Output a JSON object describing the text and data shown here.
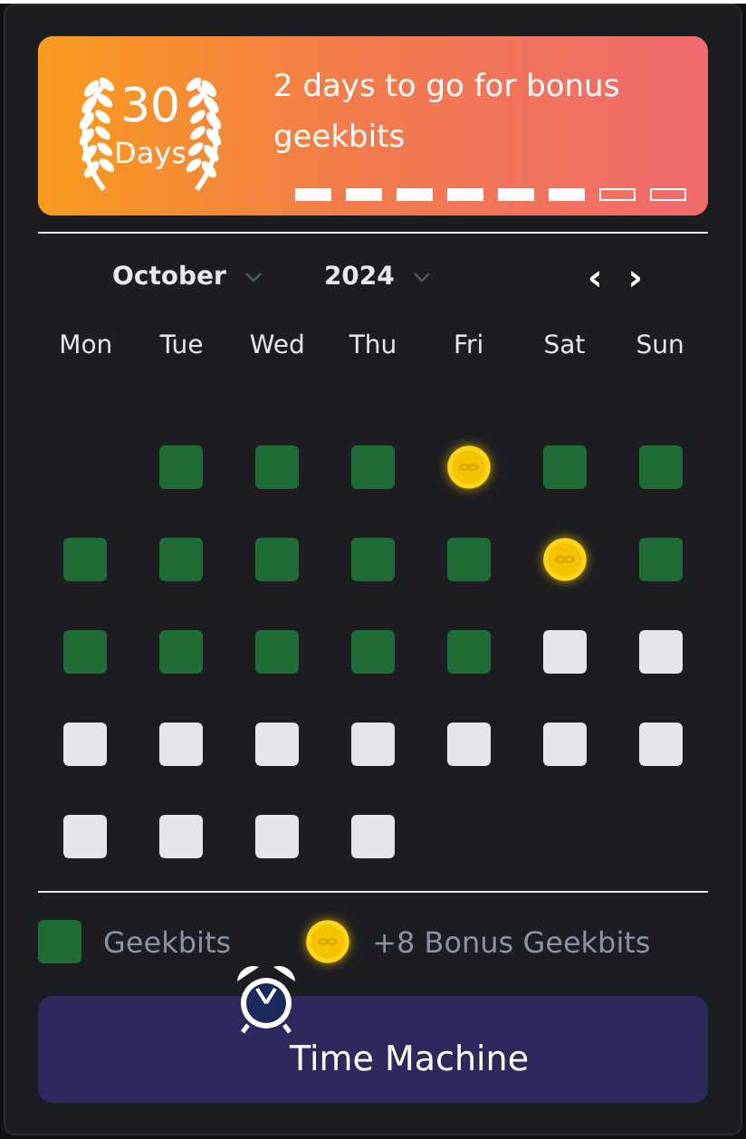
{
  "banner": {
    "count": "30",
    "unit": "Days",
    "message": "2 days to go for bonus geekbits",
    "segments": [
      {
        "filled": true
      },
      {
        "filled": true
      },
      {
        "filled": true
      },
      {
        "filled": true
      },
      {
        "filled": true
      },
      {
        "filled": true
      },
      {
        "filled": false
      },
      {
        "filled": false
      }
    ]
  },
  "calendar": {
    "month": "October",
    "year": "2024",
    "prev": "‹",
    "next": "›",
    "weekdays": [
      "Mon",
      "Tue",
      "Wed",
      "Thu",
      "Fri",
      "Sat",
      "Sun"
    ],
    "days": [
      {
        "kind": "blank"
      },
      {
        "kind": "done"
      },
      {
        "kind": "done"
      },
      {
        "kind": "done"
      },
      {
        "kind": "bonus"
      },
      {
        "kind": "done"
      },
      {
        "kind": "done"
      },
      {
        "kind": "done"
      },
      {
        "kind": "done"
      },
      {
        "kind": "done"
      },
      {
        "kind": "done"
      },
      {
        "kind": "done"
      },
      {
        "kind": "bonus"
      },
      {
        "kind": "done"
      },
      {
        "kind": "done"
      },
      {
        "kind": "done"
      },
      {
        "kind": "done"
      },
      {
        "kind": "done"
      },
      {
        "kind": "done"
      },
      {
        "kind": "empty"
      },
      {
        "kind": "empty"
      },
      {
        "kind": "empty"
      },
      {
        "kind": "empty"
      },
      {
        "kind": "empty"
      },
      {
        "kind": "empty"
      },
      {
        "kind": "empty"
      },
      {
        "kind": "empty"
      },
      {
        "kind": "empty"
      },
      {
        "kind": "empty"
      },
      {
        "kind": "empty"
      },
      {
        "kind": "empty"
      },
      {
        "kind": "empty"
      }
    ]
  },
  "legend": [
    {
      "kind": "done",
      "label": "Geekbits"
    },
    {
      "kind": "bonus",
      "label": "+8 Bonus Geekbits"
    }
  ],
  "button": {
    "label": "Time Machine"
  }
}
